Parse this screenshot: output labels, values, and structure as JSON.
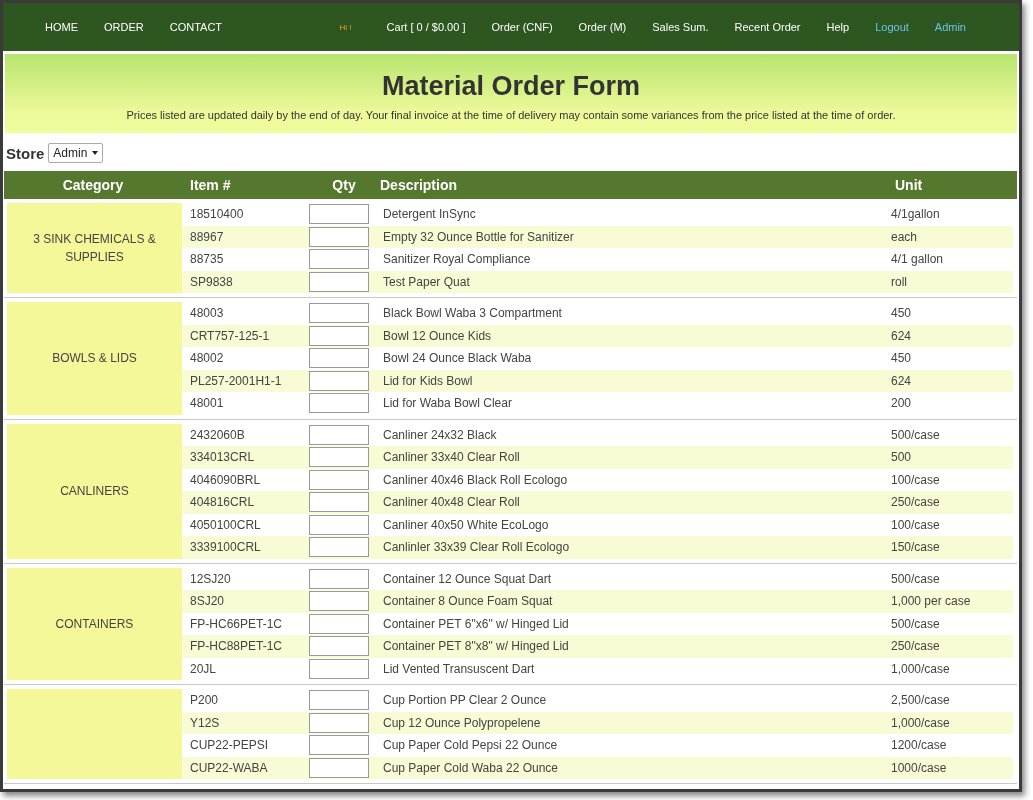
{
  "nav": {
    "left": [
      {
        "label": "HOME",
        "kind": "link"
      },
      {
        "label": "ORDER",
        "kind": "link"
      },
      {
        "label": "CONTACT",
        "kind": "link"
      }
    ],
    "right": [
      {
        "label": "Hi !",
        "kind": "greeting"
      },
      {
        "label": "Cart [ 0 / $0.00 ]",
        "kind": "link"
      },
      {
        "label": "Order (CNF)",
        "kind": "link"
      },
      {
        "label": "Order (M)",
        "kind": "link"
      },
      {
        "label": "Sales Sum.",
        "kind": "link"
      },
      {
        "label": "Recent Order",
        "kind": "link"
      },
      {
        "label": "Help",
        "kind": "link"
      },
      {
        "label": "Logout",
        "kind": "account"
      },
      {
        "label": "Admin",
        "kind": "account"
      }
    ]
  },
  "header": {
    "title": "Material Order Form",
    "notice": "Prices listed are updated daily by the end of day. Your final invoice at the time of delivery may contain some variances from the price listed at the time of order."
  },
  "store": {
    "label": "Store",
    "value": "Admin"
  },
  "table": {
    "columns": [
      "Category",
      "Item #",
      "Qty",
      "Description",
      "Unit"
    ],
    "groups": [
      {
        "category": "3 SINK CHEMICALS & SUPPLIES",
        "rows": [
          {
            "item": "18510400",
            "description": "Detergent InSync",
            "unit": "4/1gallon"
          },
          {
            "item": "88967",
            "description": "Empty 32 Ounce Bottle for Sanitizer",
            "unit": "each"
          },
          {
            "item": "88735",
            "description": "Sanitizer Royal Compliance",
            "unit": "4/1 gallon"
          },
          {
            "item": "SP9838",
            "description": "Test Paper Quat",
            "unit": "roll"
          }
        ]
      },
      {
        "category": "BOWLS & LIDS",
        "rows": [
          {
            "item": "48003",
            "description": "Black Bowl Waba 3 Compartment",
            "unit": "450"
          },
          {
            "item": "CRT757-125-1",
            "description": "Bowl 12 Ounce Kids",
            "unit": "624"
          },
          {
            "item": "48002",
            "description": "Bowl 24 Ounce Black Waba",
            "unit": "450"
          },
          {
            "item": "PL257-2001H1-1",
            "description": "Lid for Kids Bowl",
            "unit": "624"
          },
          {
            "item": "48001",
            "description": "Lid for Waba Bowl Clear",
            "unit": "200"
          }
        ]
      },
      {
        "category": "CANLINERS",
        "rows": [
          {
            "item": "2432060B",
            "description": "Canliner 24x32 Black",
            "unit": "500/case"
          },
          {
            "item": "334013CRL",
            "description": "Canliner 33x40 Clear Roll",
            "unit": "500"
          },
          {
            "item": "4046090BRL",
            "description": "Canliner 40x46 Black Roll Ecologo",
            "unit": "100/case"
          },
          {
            "item": "404816CRL",
            "description": "Canliner 40x48 Clear Roll",
            "unit": "250/case"
          },
          {
            "item": "4050100CRL",
            "description": "Canliner 40x50 White EcoLogo",
            "unit": "100/case"
          },
          {
            "item": "3339100CRL",
            "description": "Canlinler 33x39 Clear Roll Ecologo",
            "unit": "150/case"
          }
        ]
      },
      {
        "category": "CONTAINERS",
        "rows": [
          {
            "item": "12SJ20",
            "description": "Container 12 Ounce Squat Dart",
            "unit": "500/case"
          },
          {
            "item": "8SJ20",
            "description": "Container 8 Ounce Foam Squat",
            "unit": "1,000 per case"
          },
          {
            "item": "FP-HC66PET-1C",
            "description": "Container PET 6\"x6\" w/ Hinged Lid",
            "unit": "500/case"
          },
          {
            "item": "FP-HC88PET-1C",
            "description": "Container PET 8\"x8\" w/ Hinged Lid",
            "unit": "250/case"
          },
          {
            "item": "20JL",
            "description": "Lid Vented Transuscent Dart",
            "unit": "1,000/case"
          }
        ]
      },
      {
        "rows": [
          {
            "item": "P200",
            "description": "Cup Portion PP Clear 2 Ounce",
            "unit": "2,500/case"
          },
          {
            "item": "Y12S",
            "description": "Cup 12 Ounce Polypropelene",
            "unit": "1,000/case"
          },
          {
            "item": "CUP22-PEPSI",
            "description": "Cup Paper Cold Pepsi 22 Ounce",
            "unit": "1200/case"
          },
          {
            "item": "CUP22-WABA",
            "description": "Cup Paper Cold Waba 22 Ounce",
            "unit": "1000/case"
          }
        ]
      }
    ]
  }
}
